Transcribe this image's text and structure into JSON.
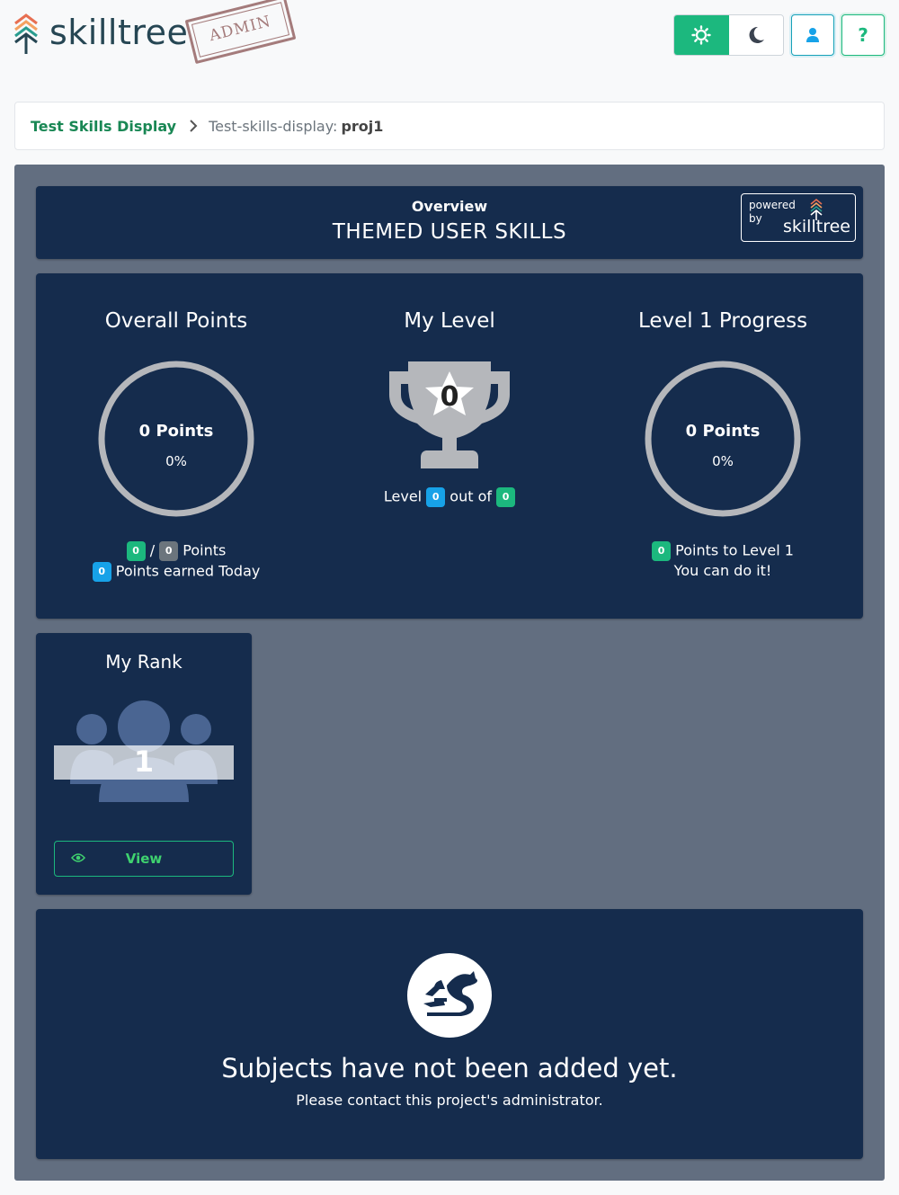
{
  "header": {
    "brand": "skilltree",
    "stamp": "ADMIN",
    "colors": {
      "accent": "#1cb87e",
      "brand_text": "#264653",
      "stamp": "#a47b7b"
    }
  },
  "breadcrumb": {
    "home": "Test Skills Display",
    "prefix": "Test-skills-display:",
    "current": "proj1"
  },
  "overview": {
    "label": "Overview",
    "title": "THEMED USER SKILLS",
    "powered_by": "powered by",
    "powered_brand": "skilltree"
  },
  "overall_points": {
    "title": "Overall Points",
    "ring_points": "0 Points",
    "ring_percent": "0%",
    "earned": "0",
    "total": "0",
    "slash": "/",
    "points_label": "Points",
    "today": "0",
    "today_label": "Points earned Today"
  },
  "my_level": {
    "title": "My Level",
    "trophy_level": "0",
    "level_label": "Level",
    "level": "0",
    "out_of_label": "out of",
    "max_level": "0"
  },
  "level_progress": {
    "title": "Level 1 Progress",
    "ring_points": "0 Points",
    "ring_percent": "0%",
    "points_to_next": "0",
    "points_to_label": "Points to Level 1",
    "encouragement": "You can do it!"
  },
  "my_rank": {
    "title": "My Rank",
    "rank": "1",
    "view_label": "View"
  },
  "subjects": {
    "title": "Subjects have not been added yet.",
    "subtitle": "Please contact this project's administrator."
  },
  "icons": [
    "skilltree-logo-icon",
    "sun-icon",
    "moon-icon",
    "user-icon",
    "question-icon",
    "chevron-right-icon",
    "trophy-icon",
    "users-icon",
    "eye-icon",
    "dragon-icon"
  ]
}
